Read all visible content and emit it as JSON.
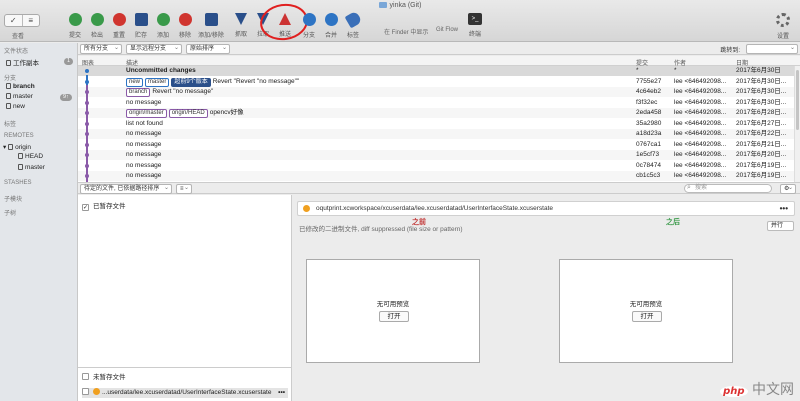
{
  "window": {
    "title": "yinka (Git)"
  },
  "toolbar": {
    "view_label": "查看",
    "items": [
      {
        "label": "提交"
      },
      {
        "label": "检出"
      },
      {
        "label": "重置"
      },
      {
        "label": "贮存"
      },
      {
        "label": "添加"
      },
      {
        "label": "移除"
      },
      {
        "label": "添加/移除"
      },
      {
        "label": "抓取"
      },
      {
        "label": "拉取"
      },
      {
        "label": "推送"
      },
      {
        "label": "分支"
      },
      {
        "label": "合并"
      },
      {
        "label": "标签"
      }
    ],
    "finder_label": "在 Finder 中显示",
    "gitflow_label": "Git Flow",
    "terminal_label": "终端",
    "settings_label": "设置"
  },
  "filters": {
    "branches": "所有分支",
    "remote": "显示远程分支",
    "order": "原始排序",
    "jump_label": "跳转到:"
  },
  "sidebar": {
    "file_status_head": "文件状态",
    "working_copy": "工作副本",
    "working_copy_badge": "1",
    "branches_head": "分支",
    "branches": [
      {
        "name": "branch",
        "badge": ""
      },
      {
        "name": "master",
        "badge": "9↑"
      },
      {
        "name": "new",
        "badge": ""
      }
    ],
    "tags_head": "标签",
    "remotes_head": "REMOTES",
    "remote_name": "origin",
    "remote_branches": [
      "HEAD",
      "master"
    ],
    "stashes_head": "STASHES",
    "submodules_head": "子模块",
    "subtrees_head": "子树"
  },
  "table": {
    "headers": {
      "graph": "图表",
      "desc": "描述",
      "commit": "提交",
      "author": "作者",
      "date": "日期"
    },
    "rows": [
      {
        "tags": [],
        "desc": "Uncommitted changes",
        "hash": "*",
        "author": "*",
        "date": "2017年6月30日",
        "bold": true
      },
      {
        "tags": [
          {
            "t": "new",
            "c": "blue"
          },
          {
            "t": "master",
            "c": "blue"
          },
          {
            "t": "超前9个版本",
            "c": "dark"
          }
        ],
        "desc": "Revert \"Revert \"no message\"\"",
        "hash": "7755e27",
        "author": "lee <646492098...",
        "date": "2017年6月30日..."
      },
      {
        "tags": [
          {
            "t": "branch",
            "c": "purple"
          }
        ],
        "desc": "Revert \"no message\"",
        "hash": "4c64eb2",
        "author": "lee <646492098...",
        "date": "2017年6月30日..."
      },
      {
        "tags": [],
        "desc": "no message",
        "hash": "f3f32ec",
        "author": "lee <646492098...",
        "date": "2017年6月30日..."
      },
      {
        "tags": [
          {
            "t": "origin/master",
            "c": "purple"
          },
          {
            "t": "origin/HEAD",
            "c": "purple"
          }
        ],
        "desc": "opencv好像",
        "hash": "2eda458",
        "author": "lee <646492098...",
        "date": "2017年6月28日..."
      },
      {
        "tags": [],
        "desc": "list not found",
        "hash": "35a2980",
        "author": "lee <646492098...",
        "date": "2017年6月27日..."
      },
      {
        "tags": [],
        "desc": "no message",
        "hash": "a18d23a",
        "author": "lee <646492098...",
        "date": "2017年6月22日..."
      },
      {
        "tags": [],
        "desc": "no message",
        "hash": "0767ca1",
        "author": "lee <646492098...",
        "date": "2017年6月21日..."
      },
      {
        "tags": [],
        "desc": "no message",
        "hash": "1e5cf73",
        "author": "lee <646492098...",
        "date": "2017年6月20日..."
      },
      {
        "tags": [],
        "desc": "no message",
        "hash": "0c78474",
        "author": "lee <646492098...",
        "date": "2017年6月19日..."
      },
      {
        "tags": [],
        "desc": "no message",
        "hash": "cb1c5c3",
        "author": "lee <646492098...",
        "date": "2017年6月19日..."
      }
    ]
  },
  "bar2": {
    "file_filter": "待定的文件, 已依据路径排序",
    "search_placeholder": "搜索"
  },
  "staged": {
    "head": "已暂存文件"
  },
  "unstaged": {
    "head": "未暂存文件",
    "file": "...userdata/lee.xcuserdatad/UserInterfaceState.xcuserstate"
  },
  "diff": {
    "path": "oqutprint.xcworkspace/xcuserdata/lee.xcuserdatad/UserInterfaceState.xcuserstate",
    "message": "已修改的二进制文件, diff suppressed (file size or pattern)",
    "option": "并行",
    "before_label": "之前",
    "after_label": "之后",
    "no_preview": "无可用预览",
    "open_label": "打开"
  },
  "watermark": {
    "php": "php",
    "text": "中文网"
  }
}
